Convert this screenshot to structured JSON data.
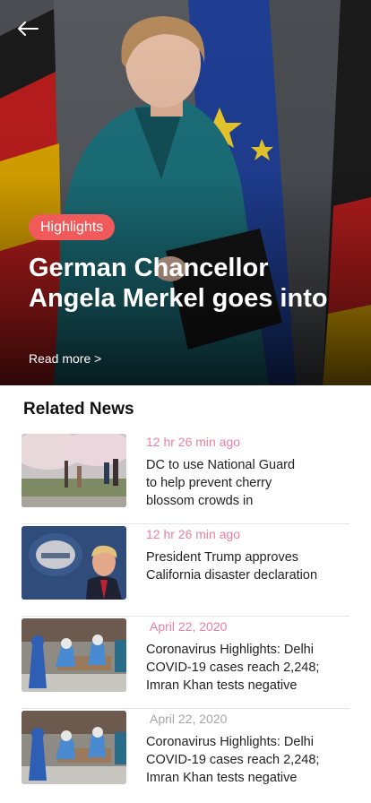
{
  "hero": {
    "badge": "Highlights",
    "title_line1": "German Chancellor",
    "title_line2": "Angela Merkel goes into",
    "read_more": "Read more >",
    "photo": "woman-in-teal-jacket-with-german-and-eu-flags"
  },
  "nav": {
    "back_icon": "arrow-left-icon"
  },
  "related": {
    "title": "Related News",
    "items": [
      {
        "time": "12 hr 26 min ago",
        "line1": "DC to use National Guard",
        "line2": "to help prevent cherry",
        "line3": "blossom crowds in",
        "thumb": "cherry-blossom-crowd-photo"
      },
      {
        "time": "12 hr 26 min ago",
        "line1": "President Trump approves",
        "line2": "California disaster declaration",
        "line3": "",
        "thumb": "press-briefing-photo"
      },
      {
        "time": "April 22, 2020",
        "line1": "Coronavirus Highlights: Delhi",
        "line2": "COVID-19 cases reach 2,248;",
        "line3": "Imran Khan tests negative",
        "thumb": "hazmat-workers-photo"
      },
      {
        "time": "April 22, 2020",
        "line1": "Coronavirus Highlights: Delhi",
        "line2": "COVID-19 cases reach 2,248;",
        "line3": "Imran Khan tests negative",
        "thumb": "hazmat-workers-photo"
      }
    ]
  },
  "colors": {
    "badge_bg": "#f05a5a",
    "time_pink": "#ef7fa0",
    "time_grey": "#a6a6a6"
  }
}
